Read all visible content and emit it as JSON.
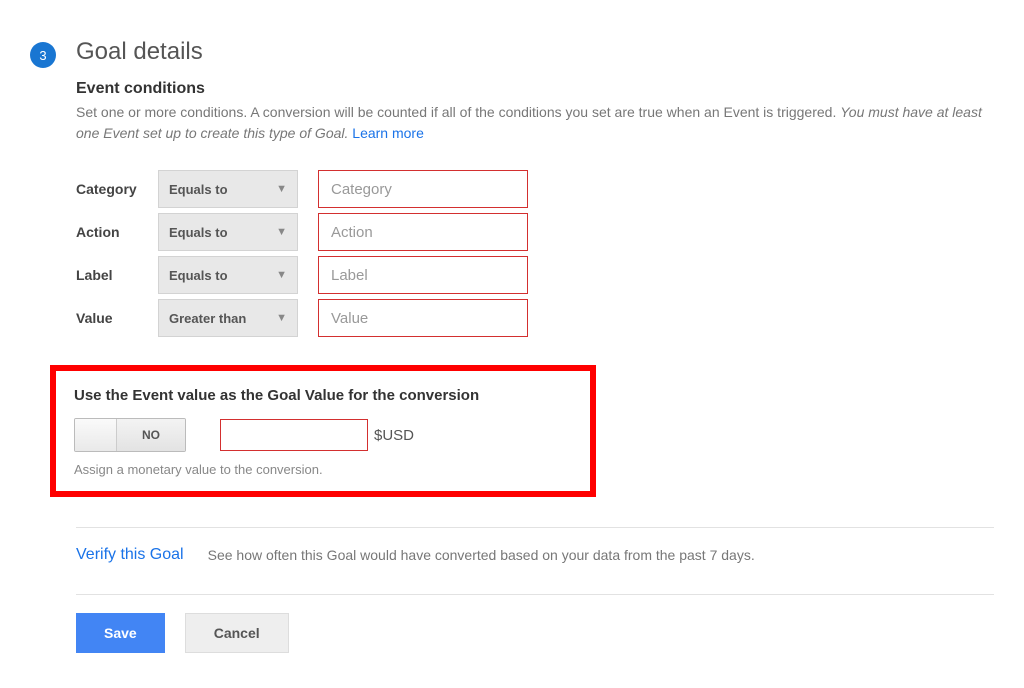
{
  "step_number": "3",
  "title": "Goal details",
  "section_title": "Event conditions",
  "description_plain": "Set one or more conditions. A conversion will be counted if all of the conditions you set are true when an Event is triggered. ",
  "description_italic": "You must have at least one Event set up to create this type of Goal. ",
  "learn_more": "Learn more",
  "conditions": [
    {
      "label": "Category",
      "operator": "Equals to",
      "placeholder": "Category"
    },
    {
      "label": "Action",
      "operator": "Equals to",
      "placeholder": "Action"
    },
    {
      "label": "Label",
      "operator": "Equals to",
      "placeholder": "Label"
    },
    {
      "label": "Value",
      "operator": "Greater than",
      "placeholder": "Value"
    }
  ],
  "goal_value": {
    "title": "Use the Event value as the Goal Value for the conversion",
    "toggle_state": "NO",
    "currency": "$USD",
    "hint": "Assign a monetary value to the conversion."
  },
  "verify": {
    "link": "Verify this Goal",
    "desc": "See how often this Goal would have converted based on your data from the past 7 days."
  },
  "buttons": {
    "save": "Save",
    "cancel": "Cancel"
  }
}
